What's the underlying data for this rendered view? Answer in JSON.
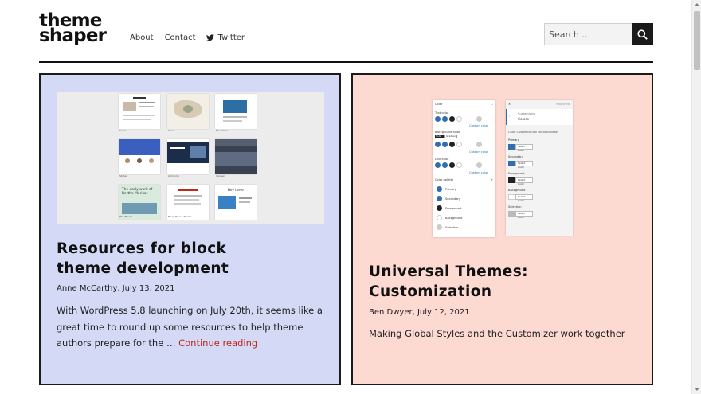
{
  "site": {
    "logo_line1": "theme",
    "logo_line2": "shaper",
    "nav": [
      "About",
      "Contact",
      "Twitter"
    ],
    "search_placeholder": "Search …"
  },
  "posts": [
    {
      "title_line1": "Resources for block",
      "title_line2": "theme development",
      "author": "Anne McCarthy",
      "date": "July 13, 2021",
      "excerpt": "With WordPress 5.8 launching on July 20th, it seems like a great time to round up some resources to help theme authors prepare for the …",
      "more": "Continue reading",
      "bg": "#d4d9f6"
    },
    {
      "title_line1": "Universal Themes:",
      "title_line2": "Customization",
      "author": "Ben Dwyer",
      "date": "July 12, 2021",
      "excerpt": "Making Global Styles and the Customizer work together",
      "bg": "#fcd9d1"
    }
  ],
  "thumb_left": {
    "tiles": [
      "Seed",
      "Clove",
      "Blockbase",
      "Stybal",
      "Armanda",
      "Hansen",
      "TT1 Blocks",
      "Block Based Theme",
      "Hey there"
    ],
    "hero_text": "The early work of Berthe Morisot"
  },
  "thumb_right": {
    "panel1_title": "Color",
    "text_color": "Text color",
    "background_color": "Background color",
    "solid": "Solid",
    "gradient": "Gradient",
    "link_color": "Link color",
    "custom_color": "Custom color",
    "palette": "Color palette",
    "palette_items": [
      "Primary",
      "Secondary",
      "Foreground",
      "Background",
      "Selection"
    ],
    "panel2_header": "Customizing",
    "panel2_title": "Colors",
    "panel2_publish": "Published",
    "panel2_sub": "Color Customization for Blockbase",
    "groups": [
      "Primary",
      "Secondary",
      "Foreground",
      "Background",
      "Selection"
    ],
    "select_color": "Select Color"
  },
  "colors": {
    "accent_link": "#c0281a",
    "header_rule": "#111111",
    "palette_blue": "#2f6fb0"
  }
}
